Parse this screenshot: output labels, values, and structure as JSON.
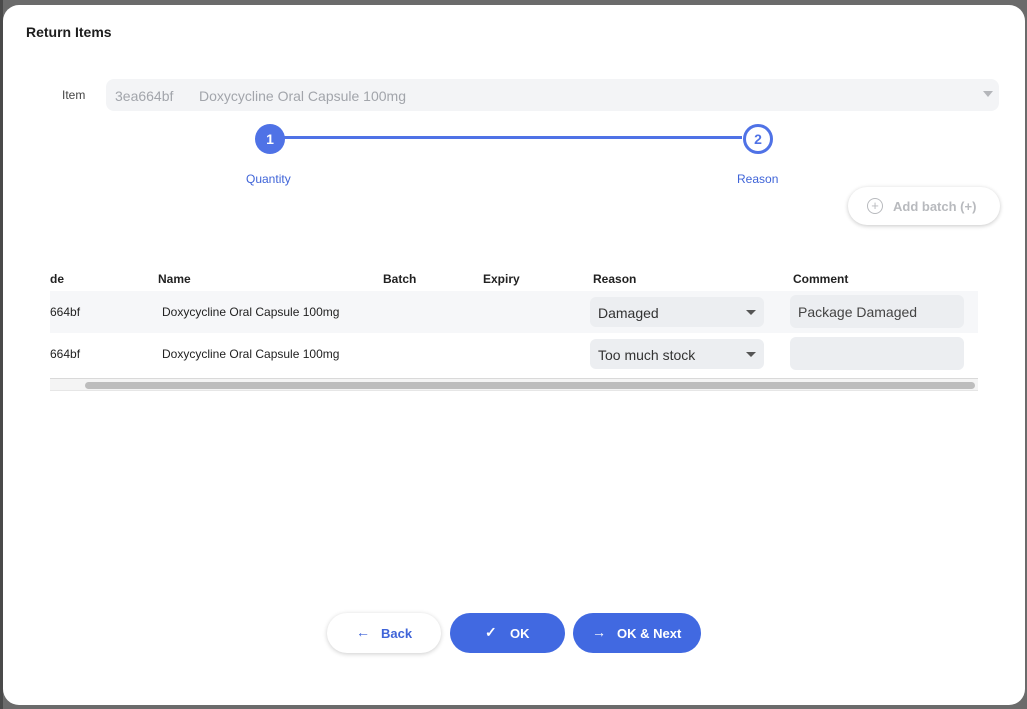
{
  "dialog": {
    "title": "Return Items"
  },
  "item": {
    "label": "Item",
    "code": "3ea664bf",
    "name": "Doxycycline Oral Capsule 100mg"
  },
  "stepper": {
    "steps": [
      {
        "number": "1",
        "label": "Quantity",
        "state": "completed"
      },
      {
        "number": "2",
        "label": "Reason",
        "state": "active"
      }
    ],
    "accent": "#4f72e6"
  },
  "actions": {
    "add_batch_label": "Add batch (+)"
  },
  "table": {
    "columns": [
      "de",
      "Name",
      "Batch",
      "Expiry",
      "Reason",
      "Comment"
    ],
    "rows": [
      {
        "code": "664bf",
        "name": "Doxycycline Oral Capsule 100mg",
        "batch": "",
        "expiry": "",
        "reason": "Damaged",
        "comment": "Package Damaged"
      },
      {
        "code": "664bf",
        "name": "Doxycycline Oral Capsule 100mg",
        "batch": "",
        "expiry": "",
        "reason": "Too much stock",
        "comment": ""
      }
    ]
  },
  "footer": {
    "back_label": "Back",
    "ok_label": "OK",
    "ok_next_label": "OK & Next"
  },
  "icons": {
    "back": "arrow-left-icon",
    "ok": "check-icon",
    "ok_next": "arrow-right-icon",
    "add": "plus-circle-icon",
    "caret": "chevron-down-icon"
  },
  "colors": {
    "primary": "#4169e1",
    "disabled_text": "#b8babe"
  }
}
